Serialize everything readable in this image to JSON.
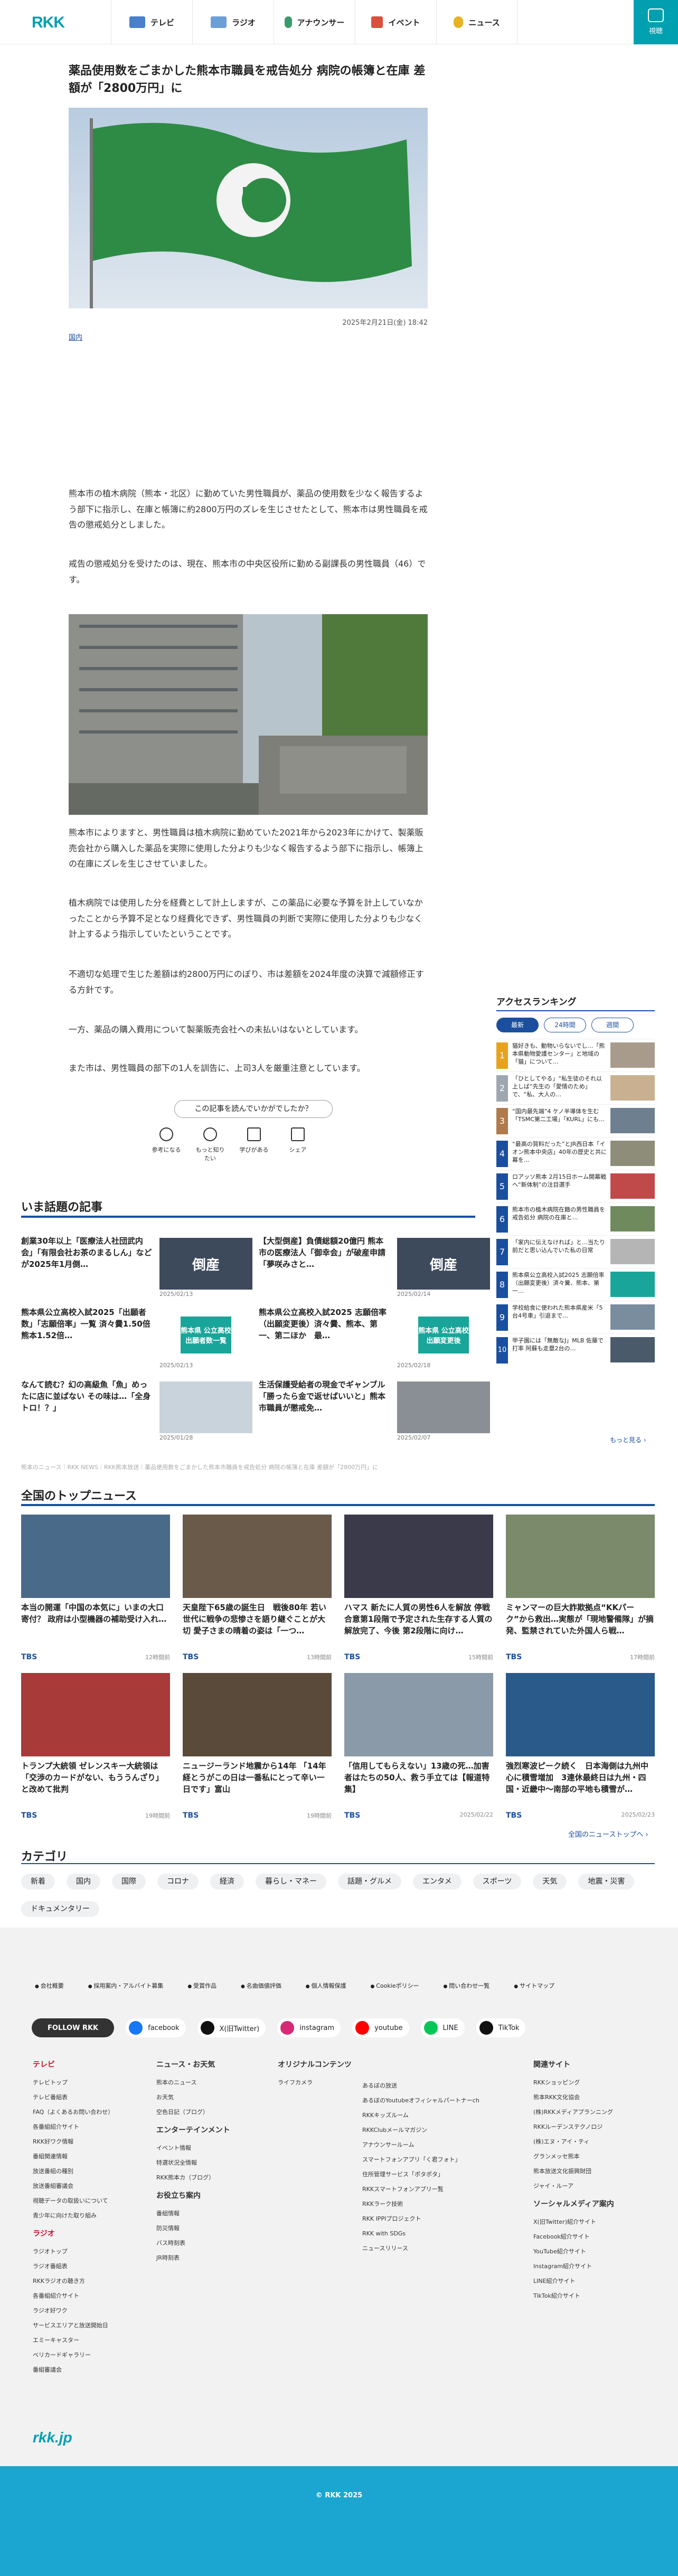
{
  "header": {
    "logo": "RKK",
    "nav": [
      {
        "label": "テレビ",
        "icon": "tv-icon",
        "color": "#4a7fc9"
      },
      {
        "label": "ラジオ",
        "icon": "radio-icon",
        "color": "#6b9fd8"
      },
      {
        "label": "アナウンサー",
        "icon": "microphone-icon",
        "color": "#3b9a6b"
      },
      {
        "label": "イベント",
        "icon": "event-icon",
        "color": "#d8513c"
      },
      {
        "label": "ニュース",
        "icon": "bulb-icon",
        "color": "#e8b323"
      }
    ],
    "menu_label": "視聴",
    "accent": "#00a0b0"
  },
  "article": {
    "title": "薬品使用数をごまかした熊本市職員を戒告処分 病院の帳簿と在庫 差額が「2800万円」に",
    "date": "2025年2月21日(金) 18:42",
    "category_tag": "国内",
    "paragraphs": [
      "熊本市の植木病院（熊本・北区）に勤めていた男性職員が、薬品の使用数を少なく報告するよう部下に指示し、在庫と帳簿に約2800万円のズレを生じさせたとして、熊本市は男性職員を戒告の懲戒処分としました。",
      "戒告の懲戒処分を受けたのは、現在、熊本市の中央区役所に勤める副課長の男性職員（46）です。",
      "熊本市によりますと、男性職員は植木病院に勤めていた2021年から2023年にかけて、製薬販売会社から購入した薬品を実際に使用した分よりも少なく報告するよう部下に指示し、帳簿上の在庫にズレを生じさせていました。",
      "植木病院では使用した分を経費として計上しますが、この薬品に必要な予算を計上していなかったことから予算不足となり経費化できず、男性職員の判断で実際に使用した分よりも少なく計上するよう指示していたということです。",
      "不適切な処理で生じた差額は約2800万円にのぼり、市は差額を2024年度の決算で減額修正する方針です。",
      "一方、薬品の購入費用について製薬販売会社への未払いはないとしています。",
      "また市は、男性職員の部下の1人を訓告に、上司3人を厳重注意としています。"
    ],
    "feedback_question": "この記事を読んでいかがでしたか？",
    "feedback": [
      "参考になる",
      "もっと知りたい",
      "学びがある",
      "シェア"
    ]
  },
  "topics": {
    "heading": "いま話題の記事",
    "items": [
      {
        "title": "創業30年以上「医療法人社団武内会」「有限会社お茶のまるしん」などが2025年1月倒…",
        "date": "2025/02/13",
        "thumb": "倒産",
        "bg": "#3d4a5c"
      },
      {
        "title": "【大型倒産】負債総額20億円 熊本市の医療法人「御幸会」が破産申請 「夢咲みさと…",
        "date": "2025/02/14",
        "thumb": "倒産",
        "bg": "#3d4a5c"
      },
      {
        "title": "熊本県公立高校入試2025「出願者数」「志願倍率」一覧 済々黌1.50倍 熊本1.52倍…",
        "date": "2025/02/13",
        "thumb": "熊本県 公立高校 出願者数一覧",
        "bg": "#1aa59a"
      },
      {
        "title": "熊本県公立高校入試2025 志願倍率（出願変更後）済々黌、熊本、第一、第二ほか　最…",
        "date": "2025/02/18",
        "thumb": "熊本県 公立高校 出願変更後",
        "bg": "#1aa59a"
      },
      {
        "title": "なんて読む？幻の高級魚「魚」めったに店に並ばない その味は…「全身トロ！？」",
        "date": "2025/01/28",
        "thumb": "",
        "bg": "#c9d3db"
      },
      {
        "title": "生活保護受給者の現金でギャンブル「勝ったら金で返せばいいと」熊本市職員が懲戒免…",
        "date": "2025/02/07",
        "thumb": "",
        "bg": "#8a8f96"
      }
    ]
  },
  "breadcrumb": "熊本のニュース｜RKK NEWS｜RKK熊本放送｜薬品使用数をごまかした熊本市職員を戒告処分 病院の帳簿と在庫 差額が「2800万円」に",
  "ranking": {
    "heading": "アクセスランキング",
    "tabs": [
      "最新",
      "24時間",
      "週間"
    ],
    "items": [
      {
        "num": "1",
        "text": "猫好きも、動物いらないでし…「熊本県動物愛護センター」と地域の「猫」について…",
        "color": "#e8a31c",
        "img": "#a89b8c"
      },
      {
        "num": "2",
        "text": "「ひとしてやる」“私生徒のそれ以上しば”先生の「愛情のため」で、“私、大人の…",
        "color": "#9ea7b0",
        "img": "#c9b090"
      },
      {
        "num": "3",
        "text": "“国内最先端”4 ケノ半導体を生む「TSMC第二工場」「KURL」にも…",
        "color": "#b07a4a",
        "img": "#6e7f8f"
      },
      {
        "num": "4",
        "text": "“最高の賀料だった”とJR西日本「イオン熊本中央店」40年の歴史と共に幕を…",
        "color": "#1a4fa0",
        "img": "#8d8d7a"
      },
      {
        "num": "5",
        "text": "ロアッソ熊本 2月15日ホーム開幕戦へ“新体制”の注目選手",
        "color": "#1a4fa0",
        "img": "#c04a4a"
      },
      {
        "num": "6",
        "text": "熊本市の植木病院在籍の男性職員を戒告処分 病院の在庫と…",
        "color": "#1a4fa0",
        "img": "#6f8a5c"
      },
      {
        "num": "7",
        "text": "「家内に伝えなければ」と…当たり前だと思い込んでいた私の日常",
        "color": "#1a4fa0",
        "img": "#b5b5b5"
      },
      {
        "num": "8",
        "text": "熊本県公立高校入試2025 志願倍率（出願変更後）済々黌、熊本、第一…",
        "color": "#1a4fa0",
        "img": "#1aa59a"
      },
      {
        "num": "9",
        "text": "学校給食に使われた熊本県産米「5台4号車」引退まで…",
        "color": "#1a4fa0",
        "img": "#7a8d9f"
      },
      {
        "num": "10",
        "text": "甲子園には「無敵なJ」MLB 佐藤で打率 阿蘇も走塁2台の…",
        "color": "#1a4fa0",
        "img": "#4a5a6a"
      }
    ],
    "more": "もっと見る ›"
  },
  "top_news": {
    "heading": "全国のトップニュース",
    "items": [
      {
        "title": "本当の開運「中国の本気に」いまの大口寄付？ 政府は小型機器の補助受け入れ…",
        "src": "TBS",
        "time": "12時間前",
        "bg": "#4a6a8a"
      },
      {
        "title": "天皇陛下65歳の誕生日　戦後80年 若い世代に戦争の悲惨さを語り継ぐことが大切 愛子さまの晴着の姿は「一つ…",
        "src": "TBS",
        "time": "13時間前",
        "bg": "#6a5a4a"
      },
      {
        "title": "ハマス 新たに人質の男性6人を解放 停戦合意第1段階で予定された生存する人質の解放完了、今後 第2段階に向け…",
        "src": "TBS",
        "time": "15時間前",
        "bg": "#3a3a4a"
      },
      {
        "title": "ミャンマーの巨大詐欺拠点“KKパーク”から救出…実態が「現地警備隊」が摘発、監禁されていた外国人ら戦…",
        "src": "TBS",
        "time": "17時間前",
        "bg": "#7a8a6a"
      },
      {
        "title": "トランプ大統領 ゼレンスキー大統領は「交渉のカードがない、もううんざり」と改めて批判",
        "src": "TBS",
        "time": "19時間前",
        "bg": "#a83a3a"
      },
      {
        "title": "ニュージーランド地震から14年 「14年経とうがこの日は一番私にとって辛い一日です」富山",
        "src": "TBS",
        "time": "19時間前",
        "bg": "#5a4a3a"
      },
      {
        "title": "「信用してもらえない」13歳の死…加害者はたちの50人、救う手立ては【報道特集】",
        "src": "TBS",
        "time": "2025/02/22",
        "bg": "#8a9aa8"
      },
      {
        "title": "強烈寒波ピーク続く　日本海側は九州中心に積雪増加　3連休最終日は九州・四国・近畿中～南部の平地も積雪が…",
        "src": "TBS",
        "time": "2025/02/23",
        "bg": "#2a5a8a"
      }
    ],
    "more": "全国のニューストップへ ›"
  },
  "categories": {
    "heading": "カテゴリ",
    "items": [
      "新着",
      "国内",
      "国際",
      "コロナ",
      "経済",
      "暮らし・マネー",
      "話題・グルメ",
      "エンタメ",
      "スポーツ",
      "天気",
      "地震・災害",
      "ドキュメンタリー"
    ]
  },
  "footer": {
    "links": [
      "会社概要",
      "採用案内・アルバイト募集",
      "受賞作品",
      "名曲価値評価",
      "個人情報保護",
      "Cookieポリシー",
      "問い合わせ一覧",
      "サイトマップ"
    ],
    "follow": "FOLLOW RKK",
    "socials": [
      {
        "label": "facebook",
        "color": "#1877f2"
      },
      {
        "label": "X(旧Twitter)",
        "color": "#111111"
      },
      {
        "label": "instagram",
        "color": "#d62976"
      },
      {
        "label": "youtube",
        "color": "#ff0000"
      },
      {
        "label": "LINE",
        "color": "#06c755"
      },
      {
        "label": "TikTok",
        "color": "#111111"
      }
    ],
    "cols": [
      {
        "heading": "テレビ",
        "red": true,
        "items": [
          "テレビトップ",
          "テレビ番組表",
          "FAQ（よくあるお問い合わせ）",
          "各番組紹介サイト",
          "RKK好ワク情報",
          "番組関連情報",
          "放送番組の種別",
          "放送番組審議会",
          "視聴データの取扱いについて",
          "青少年に向けた取り組み"
        ],
        "heading2": "ラジオ",
        "items2": [
          "ラジオトップ",
          "ラジオ番組表",
          "RKKラジオの聴き方",
          "各番組紹介サイト",
          "ラジオ好ワク",
          "サービスエリアと放送開始日",
          "エミーキャスター",
          "ベリカードギャラリー",
          "番組審議会"
        ]
      },
      {
        "heading": "ニュース・お天気",
        "items": [
          "熊本のニュース",
          "お天気",
          "空色日記（ブログ）"
        ],
        "heading2": "エンターテインメント",
        "items2": [
          "イベント情報",
          "特選状況全情報",
          "RKK熊本カ（ブログ）"
        ],
        "heading3": "お役立ち案内",
        "items3": [
          "番組情報",
          "防災情報",
          "バス時刻表",
          "JR時刻表"
        ]
      },
      {
        "heading": "オリジナルコンテンツ",
        "items": [
          "ライフカメラ"
        ],
        "extra": [
          "あるぼの放送",
          "あるぼのYoutubeオフィシャルパートナーch",
          "RKKキッズルーム",
          "RKKClubメールマガジン",
          "アナウンサールーム",
          "スマートフォンアプリ「く君フォト」",
          "住所管理サービス「ポタポタ」",
          "RKKスマートフォンアプリ一覧",
          "RKKラーク技術",
          "RKK IPPIプロジェクト",
          "RKK with SDGs",
          "ニュースリリース"
        ]
      },
      {
        "heading": "関連サイト",
        "items": [
          "RKKショッピング",
          "熊本RKK文化協会",
          "(株)RKKメディアプランニング",
          "RKKルーデンステクノロジ",
          "(株)エヌ・アイ・ティ",
          "グランメッセ熊本",
          "熊本放送文化振興財団",
          "ジャイ・ルーア"
        ],
        "heading2": "ソーシャルメディア案内",
        "items2": [
          "X(旧Twitter)紹介サイト",
          "Facebook紹介サイト",
          "YouTube紹介サイト",
          "Instagram紹介サイト",
          "LINE紹介サイト",
          "TikTok紹介サイト"
        ]
      }
    ],
    "site": "rkk.jp",
    "copyright": "© RKK 2025"
  }
}
